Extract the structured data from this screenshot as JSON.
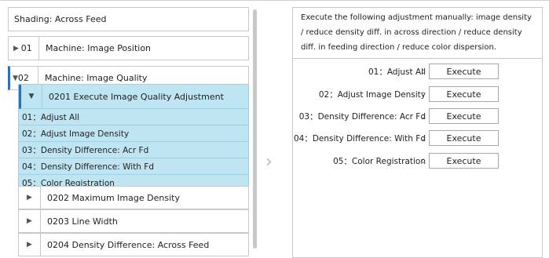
{
  "left": {
    "title": "Shading: Across Feed",
    "items": [
      {
        "arrow": "▶",
        "num": "01",
        "label": "Machine: Image Position"
      },
      {
        "arrow": "▼",
        "num": "02",
        "label": "Machine: Image Quality"
      }
    ],
    "expanded_group": {
      "arrow": "▼",
      "label": "0201 Execute Image Quality Adjustment",
      "subitems": [
        "01：Adjust All",
        "02：Adjust Image Density",
        "03：Density Difference: Acr Fd",
        "04：Density Difference: With Fd",
        "05：Color Registration"
      ]
    },
    "collapsed_groups": [
      {
        "arrow": "▶",
        "label": "0202 Maximum Image Density"
      },
      {
        "arrow": "▶",
        "label": "0203 Line Width"
      },
      {
        "arrow": "▶",
        "label": "0204 Density Difference: Across Feed"
      }
    ]
  },
  "next_chevron": "›",
  "right": {
    "description": "Execute the following adjustment manually: image density / reduce density diff. in across direction / reduce density diff. in feeding direction / reduce color dispersion.",
    "rows": [
      {
        "name": "01：Adjust All",
        "colon": ":",
        "button": "Execute"
      },
      {
        "name": "02：Adjust Image Density",
        "colon": ":",
        "button": "Execute"
      },
      {
        "name": "03：Density Difference: Acr Fd",
        "colon": ":",
        "button": "Execute"
      },
      {
        "name": "04：Density Difference: With Fd",
        "colon": ":",
        "button": "Execute"
      },
      {
        "name": "05：Color Registration",
        "colon": ":",
        "button": "Execute"
      }
    ]
  }
}
